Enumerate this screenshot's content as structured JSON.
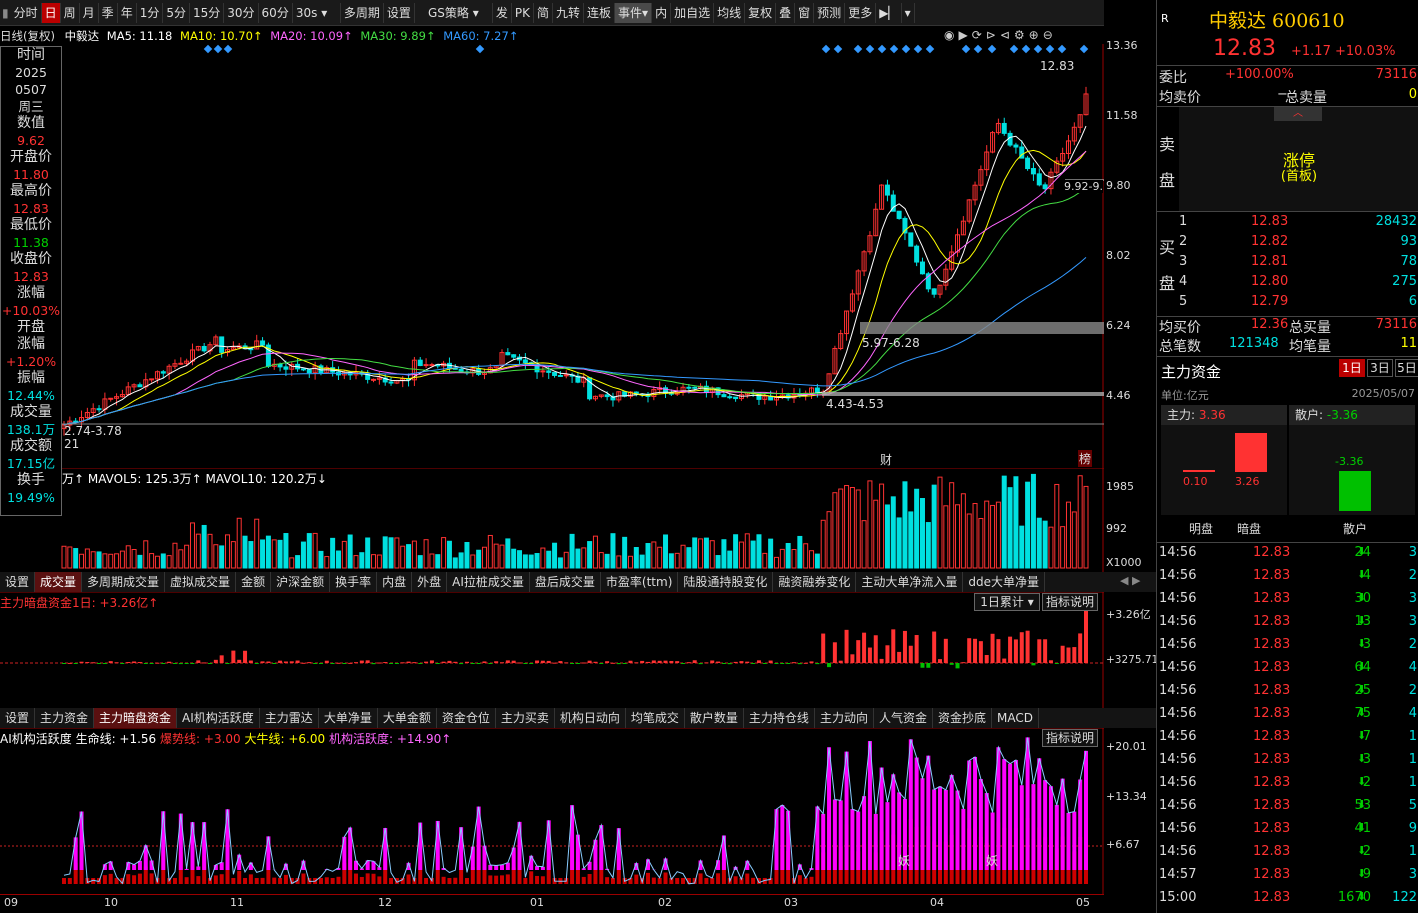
{
  "toolbar": {
    "items": [
      "分时",
      "日",
      "周",
      "月",
      "季",
      "年",
      "1分",
      "5分",
      "15分",
      "30分",
      "60分",
      "30s",
      "多周期",
      "设置",
      "GS策略",
      "发",
      "PK",
      "简",
      "九转",
      "连板",
      "事件",
      "内",
      "加自选",
      "均线",
      "复权",
      "叠",
      "窗",
      "预测",
      "更多"
    ]
  },
  "legend": {
    "period": "日线(复权)",
    "name": "中毅达",
    "ma5": "MA5: 11.18",
    "ma10": "MA10: 10.70↑",
    "ma20": "MA20: 10.09↑",
    "ma30": "MA30: 9.89↑",
    "ma60": "MA60: 7.27↑"
  },
  "info": {
    "labels": [
      "时间",
      "2025",
      "0507",
      "周三",
      "数值",
      "9.62",
      "开盘价",
      "11.80",
      "最高价",
      "12.83",
      "最低价",
      "11.38",
      "收盘价",
      "12.83",
      "涨幅",
      "+10.03%",
      "开盘",
      "涨幅",
      "+1.20%",
      "振幅",
      "12.44%",
      "成交量",
      "138.1万",
      "成交额",
      "17.15亿",
      "换手",
      "19.49%"
    ]
  },
  "price_axis": [
    "13.36",
    "11.58",
    "9.80",
    "8.02",
    "6.24",
    "4.46"
  ],
  "annotations": {
    "high": "12.83",
    "box1": "5.97-6.28",
    "box2": "4.43-4.53",
    "left": "2.74-3.78",
    "left2": "21",
    "right": "9.92-9.",
    "cai": "财",
    "bang": "榜"
  },
  "vol": {
    "legend": "万↑ MAVOL5: 125.3万↑ MAVOL10: 120.2万↓",
    "axis": [
      "1985",
      "992",
      "X1000"
    ]
  },
  "tabs1": [
    "设置",
    "成交量",
    "多周期成交量",
    "虚拟成交量",
    "金额",
    "沪深金额",
    "换手率",
    "内盘",
    "外盘",
    "AI拉桩成交量",
    "盘后成交量",
    "市盈率(ttm)",
    "陆股通持股变化",
    "融资融券变化",
    "主动大单净流入量",
    "dde大单净量"
  ],
  "dark": {
    "legend": "主力暗盘资金1日: +3.26亿↑",
    "dropdown": "1日累计",
    "explain": "指标说明",
    "axis": [
      "+3.26亿",
      "+3275.71"
    ]
  },
  "tabs2": [
    "设置",
    "主力资金",
    "主力暗盘资金",
    "AI机构活跃度",
    "主力雷达",
    "大单净量",
    "大单金额",
    "资金仓位",
    "主力买卖",
    "机构日动向",
    "均笔成交",
    "散户数量",
    "主力持仓线",
    "主力动向",
    "人气资金",
    "资金抄底",
    "MACD"
  ],
  "ai": {
    "legend_a": "AI机构活跃度 生命线: +1.56",
    "legend_b": "爆势线: +3.00",
    "legend_c": "大牛线: +6.00",
    "legend_d": "机构活跃度: +14.90↑",
    "explain": "指标说明",
    "axis": [
      "+20.01",
      "+13.34",
      "+6.67"
    ],
    "marks": [
      "妖",
      "妖"
    ]
  },
  "xaxis": [
    "09",
    "10",
    "11",
    "12",
    "01",
    "02",
    "03",
    "04",
    "05"
  ],
  "quote": {
    "flag": "R",
    "name": "中毅达 600610",
    "price": "12.83",
    "change": "+1.17",
    "pct": "+10.03%",
    "weibi_l": "委比",
    "weibi_v": "+100.00%",
    "weibi_n": "73116",
    "jmj_l": "均卖价",
    "jmj_v": "−",
    "zmm_l": "总卖量",
    "zmm_v": "0",
    "sell_l1": "卖",
    "sell_l2": "盘",
    "limit": "涨停",
    "limit2": "(首板)",
    "buy_l1": "买",
    "buy_l2": "盘",
    "bids": [
      [
        "1",
        "12.83",
        "28432"
      ],
      [
        "2",
        "12.82",
        "93"
      ],
      [
        "3",
        "12.81",
        "78"
      ],
      [
        "4",
        "12.80",
        "275"
      ],
      [
        "5",
        "12.79",
        "6"
      ]
    ],
    "jbj_l": "均买价",
    "jbj_v": "12.36",
    "zbl_l": "总买量",
    "zbl_v": "73116",
    "zbs_l": "总笔数",
    "zbs_v": "121348",
    "jbl_l": "均笔量",
    "jbl_v": "11"
  },
  "fund": {
    "title": "主力资金",
    "tabs": [
      "1日",
      "3日",
      "5日"
    ],
    "unit": "单位:亿元",
    "date": "2025/05/07",
    "zl_l": "主力:",
    "zl_v": "3.36",
    "sh_l": "散户:",
    "sh_v": "-3.36",
    "b1": "0.10",
    "b2": "3.26",
    "b3": "-3.36",
    "c1": "明盘",
    "c2": "暗盘",
    "c3": "散户"
  },
  "ticks": [
    [
      "14:56",
      "12.83",
      "24",
      "3"
    ],
    [
      "14:56",
      "12.83",
      "4",
      "2"
    ],
    [
      "14:56",
      "12.83",
      "30",
      "3"
    ],
    [
      "14:56",
      "12.83",
      "13",
      "3"
    ],
    [
      "14:56",
      "12.83",
      "3",
      "2"
    ],
    [
      "14:56",
      "12.83",
      "64",
      "4"
    ],
    [
      "14:56",
      "12.83",
      "25",
      "2"
    ],
    [
      "14:56",
      "12.83",
      "75",
      "4"
    ],
    [
      "14:56",
      "12.83",
      "7",
      "1"
    ],
    [
      "14:56",
      "12.83",
      "3",
      "1"
    ],
    [
      "14:56",
      "12.83",
      "2",
      "1"
    ],
    [
      "14:56",
      "12.83",
      "53",
      "5"
    ],
    [
      "14:56",
      "12.83",
      "41",
      "9"
    ],
    [
      "14:56",
      "12.83",
      "2",
      "1"
    ],
    [
      "14:57",
      "12.83",
      "9",
      "3"
    ],
    [
      "15:00",
      "12.83",
      "1670",
      "122"
    ]
  ],
  "colors": {
    "up": "#ff3232",
    "down": "#00d000",
    "accent": "#ff3232",
    "yellow": "#ffff00",
    "cyan": "#00e0e0",
    "magenta": "#ff00ff"
  }
}
